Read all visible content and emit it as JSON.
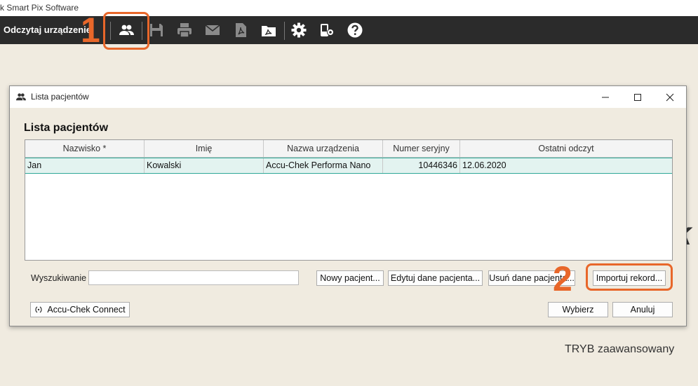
{
  "app": {
    "title": "k Smart Pix Software",
    "mode": "TRYB zaawansowany",
    "bg_letter": "k"
  },
  "toolbar": {
    "read_device_label": "Odczytaj urządzenie",
    "icons": [
      "patients-icon",
      "save-icon",
      "print-icon",
      "email-icon",
      "pdf-icon",
      "pdf-export-icon",
      "settings-icon",
      "device-settings-icon",
      "help-icon"
    ]
  },
  "callouts": {
    "one": "1",
    "two": "2",
    "accent": "#e8672a"
  },
  "dialog": {
    "title": "Lista pacjentów",
    "heading": "Lista pacjentów",
    "columns": [
      "Nazwisko *",
      "Imię",
      "Nazwa urządzenia",
      "Numer seryjny",
      "Ostatni odczyt"
    ],
    "rows": [
      {
        "last_name": "Jan",
        "first_name": "Kowalski",
        "device": "Accu-Chek Performa Nano",
        "serial": "10446346",
        "last_read": "12.06.2020"
      }
    ],
    "search_label": "Wyszukiwanie",
    "search_value": "",
    "buttons": {
      "new_patient": "Nowy pacjent...",
      "edit_patient": "Edytuj dane pacjenta...",
      "delete_patient": "Usuń dane pacjenta...",
      "import_record": "Importuj rekord...",
      "connect": "Accu-Chek Connect",
      "select": "Wybierz",
      "cancel": "Anuluj"
    },
    "selected_row_color": "#e3f3f0"
  }
}
